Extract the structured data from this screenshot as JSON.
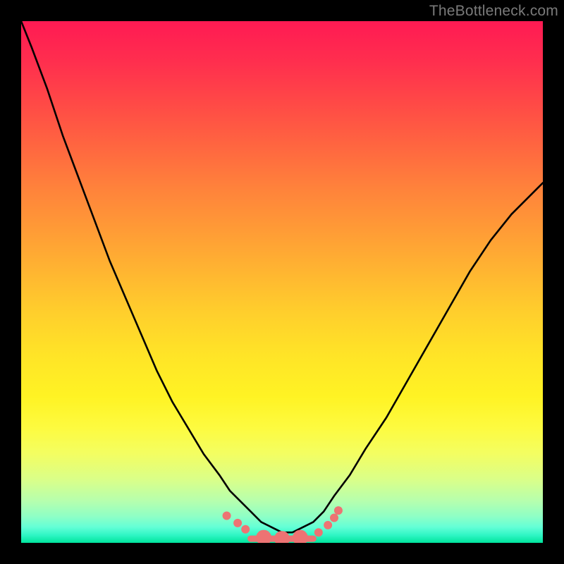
{
  "watermark": "TheBottleneck.com",
  "chart_data": {
    "type": "line",
    "x": [
      0.0,
      0.02,
      0.05,
      0.08,
      0.11,
      0.14,
      0.17,
      0.2,
      0.23,
      0.26,
      0.29,
      0.32,
      0.35,
      0.38,
      0.4,
      0.42,
      0.44,
      0.46,
      0.48,
      0.5,
      0.52,
      0.54,
      0.56,
      0.58,
      0.6,
      0.63,
      0.66,
      0.7,
      0.74,
      0.78,
      0.82,
      0.86,
      0.9,
      0.94,
      0.98,
      1.0
    ],
    "values": [
      1.0,
      0.95,
      0.87,
      0.78,
      0.7,
      0.62,
      0.54,
      0.47,
      0.4,
      0.33,
      0.27,
      0.22,
      0.17,
      0.13,
      0.1,
      0.08,
      0.06,
      0.04,
      0.03,
      0.02,
      0.02,
      0.03,
      0.04,
      0.06,
      0.09,
      0.13,
      0.18,
      0.24,
      0.31,
      0.38,
      0.45,
      0.52,
      0.58,
      0.63,
      0.67,
      0.69
    ],
    "title": "",
    "xlabel": "",
    "ylabel": "",
    "xlim": [
      0,
      1
    ],
    "ylim": [
      0,
      1
    ],
    "grid": false,
    "background_gradient": {
      "direction": "vertical",
      "stops": [
        {
          "pos": 0.0,
          "color": "#ff1a53"
        },
        {
          "pos": 0.5,
          "color": "#ffcf2c"
        },
        {
          "pos": 0.8,
          "color": "#fdfb40"
        },
        {
          "pos": 1.0,
          "color": "#00e49c"
        }
      ]
    },
    "bottom_markers": {
      "color": "#ed7373",
      "connector_width": 9,
      "points": [
        {
          "x": 0.394,
          "y": 0.052,
          "r": 6
        },
        {
          "x": 0.415,
          "y": 0.038,
          "r": 6
        },
        {
          "x": 0.43,
          "y": 0.026,
          "r": 6
        },
        {
          "x": 0.465,
          "y": 0.01,
          "r": 11
        },
        {
          "x": 0.5,
          "y": 0.008,
          "r": 11
        },
        {
          "x": 0.535,
          "y": 0.01,
          "r": 11
        },
        {
          "x": 0.57,
          "y": 0.02,
          "r": 6
        },
        {
          "x": 0.588,
          "y": 0.034,
          "r": 6
        },
        {
          "x": 0.6,
          "y": 0.048,
          "r": 6
        },
        {
          "x": 0.608,
          "y": 0.062,
          "r": 6
        }
      ],
      "connector_segments": [
        {
          "x0": 0.44,
          "x1": 0.56,
          "y": 0.008
        }
      ]
    }
  }
}
